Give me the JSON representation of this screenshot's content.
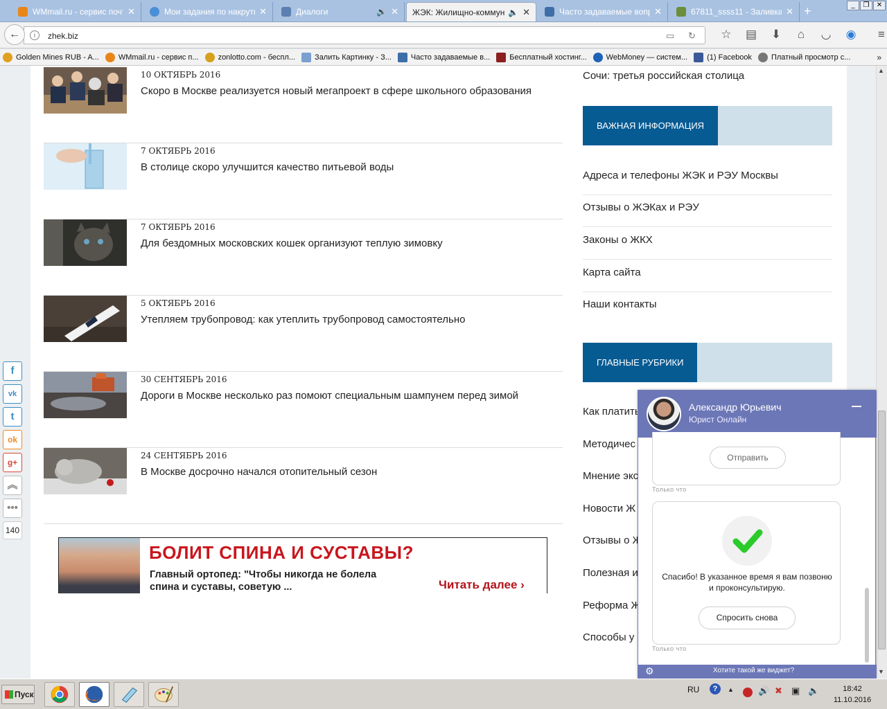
{
  "browser": {
    "tabs": [
      {
        "label": "WMmail.ru - сервис почт...",
        "icon_color": "#e9861a"
      },
      {
        "label": "Мои задания по накрутке",
        "icon_color": "#4a8fd6"
      },
      {
        "label": "Диалоги",
        "icon_color": "#5b7fb0"
      },
      {
        "label": "ЖЭК: Жилищно-коммун...",
        "icon_color": "#bbbbbb"
      },
      {
        "label": "Часто задаваемые вопр...",
        "icon_color": "#3e6ea8"
      },
      {
        "label": "67811_ssss11 - Заливка...",
        "icon_color": "#6b8e3a"
      }
    ],
    "url": "zhek.biz",
    "bookmarks": [
      {
        "label": "Golden Mines RUB - A...",
        "icon_color": "#e0a020"
      },
      {
        "label": "WMmail.ru - сервис п...",
        "icon_color": "#e9861a"
      },
      {
        "label": "zonlotto.com - беспл...",
        "icon_color": "#d6a01c"
      },
      {
        "label": "Залить Картинку - З...",
        "icon_color": "#7aa0d0"
      },
      {
        "label": "Часто задаваемые в...",
        "icon_color": "#3e6ea8"
      },
      {
        "label": "Бесплатный хостинг...",
        "icon_color": "#8b2020"
      },
      {
        "label": "WebMoney — систем...",
        "icon_color": "#1d63b8"
      },
      {
        "label": "(1) Facebook",
        "icon_color": "#3b5998"
      },
      {
        "label": "Платный просмотр с...",
        "icon_color": "#777777"
      }
    ]
  },
  "news": [
    {
      "date": "10 ОКТЯБРЬ 2016",
      "title": "Скоро в Москве реализуется новый мегапроект в сфере школьного образования",
      "thumb": "school"
    },
    {
      "date": "7 ОКТЯБРЬ 2016",
      "title": "В столице скоро улучшится качество питьевой воды",
      "thumb": "water"
    },
    {
      "date": "7 ОКТЯБРЬ 2016",
      "title": "Для бездомных московских кошек организуют теплую зимовку",
      "thumb": "kitten"
    },
    {
      "date": "5 ОКТЯБРЬ 2016",
      "title": "Утепляем трубопровод: как утеплить трубопровод самостоятельно",
      "thumb": "pipe"
    },
    {
      "date": "30 СЕНТЯБРЬ 2016",
      "title": "Дороги в Москве несколько раз помоют специальным шампунем перед зимой",
      "thumb": "road"
    },
    {
      "date": "24 СЕНТЯБРЬ 2016",
      "title": "В Москве досрочно начался отопительный сезон",
      "thumb": "cat"
    }
  ],
  "ad": {
    "headline": "БОЛИТ СПИНА И СУСТАВЫ?",
    "text": "Главный ортопед: \"Чтобы никогда не болела спина и суставы, советую ...",
    "more": "Читать далее"
  },
  "sidebar": {
    "top_link": "Сочи: третья российская столица",
    "important_header": "ВАЖНАЯ ИНФОРМАЦИЯ",
    "important_links": [
      "Адреса и телефоны ЖЭК и РЭУ Москвы",
      "Отзывы о ЖЭКах и РЭУ",
      "Законы о ЖКХ",
      "Карта сайта",
      "Наши контакты"
    ],
    "rubrics_header": "ГЛАВНЫЕ РУБРИКИ",
    "rubrics": [
      "Как платить",
      "Методичес",
      "Мнение экс",
      "Новости Ж",
      "Отзывы о Ж",
      "Полезная и",
      "Реформа Ж",
      "Способы у"
    ]
  },
  "share": {
    "buttons": [
      "f",
      "vk",
      "t",
      "ok",
      "g+",
      "up",
      "more"
    ],
    "count": "140"
  },
  "chat": {
    "name": "Александр Юрьевич",
    "role": "Юрист Онлайн",
    "send_button": "Отправить",
    "time1": "Только что",
    "thanks": "Спасибо! В указанное время я вам позвоню и проконсультирую.",
    "ask_again": "Спросить снова",
    "time2": "Только что",
    "footer": "Хотите такой же виджет?"
  },
  "taskbar": {
    "start": "Пуск",
    "lang": "RU",
    "time": "18:42",
    "date": "11.10.2016"
  }
}
